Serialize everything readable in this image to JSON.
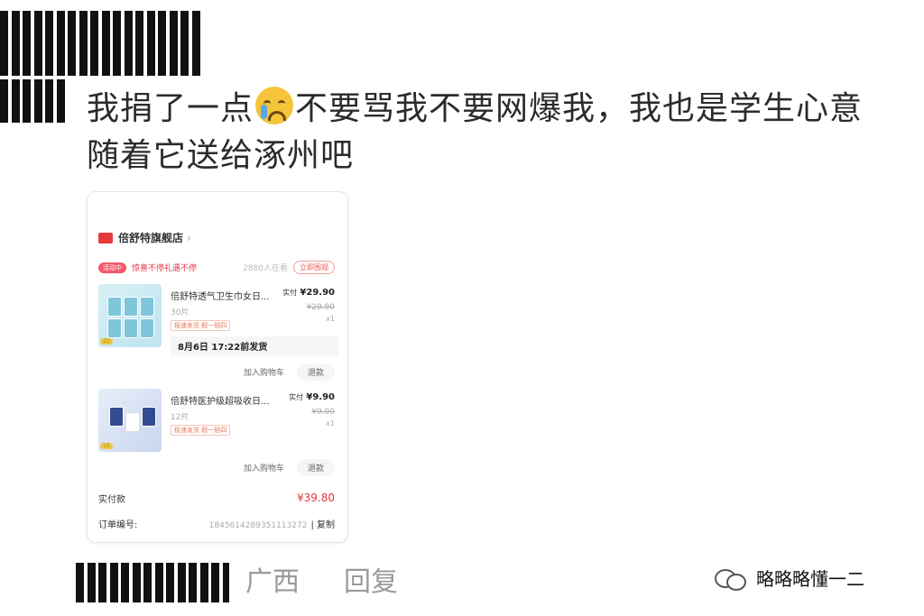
{
  "post": {
    "text_part1": "我捐了一点",
    "text_part2": "不要骂我不要网爆我，我也是学生心意随着它送给涿州吧"
  },
  "order": {
    "shop_name": "倍舒特旗舰店",
    "promo_tag": "活动中",
    "promo_text": "惊喜不停礼遇不停",
    "promo_count": "2880人在看",
    "promo_button": "立即围观",
    "items": [
      {
        "title": "倍舒特透气卫生巾女日...",
        "spec": "30片",
        "tag": "极速发货 假一赔四",
        "paid_label": "实付",
        "paid": "¥29.90",
        "original": "¥29.90",
        "qty": "x1",
        "badge": "22"
      },
      {
        "title": "倍舒特医护级超吸收日...",
        "spec": "12片",
        "tag": "极速发货 假一赔四",
        "paid_label": "实付",
        "paid": "¥9.90",
        "original": "¥9.90",
        "qty": "x1",
        "badge": "19"
      }
    ],
    "ship_note": "8月6日 17:22前发货",
    "add_to_cart": "加入购物车",
    "refund": "退款",
    "total_label": "实付款",
    "total": "¥39.80",
    "order_no_label": "订单编号:",
    "order_no": "1845614289351113272",
    "copy": "| 复制"
  },
  "footer": {
    "location": "广西",
    "reply": "回复"
  },
  "watermark": {
    "text": "略略略懂一二",
    "icon": "wechat-icon"
  }
}
